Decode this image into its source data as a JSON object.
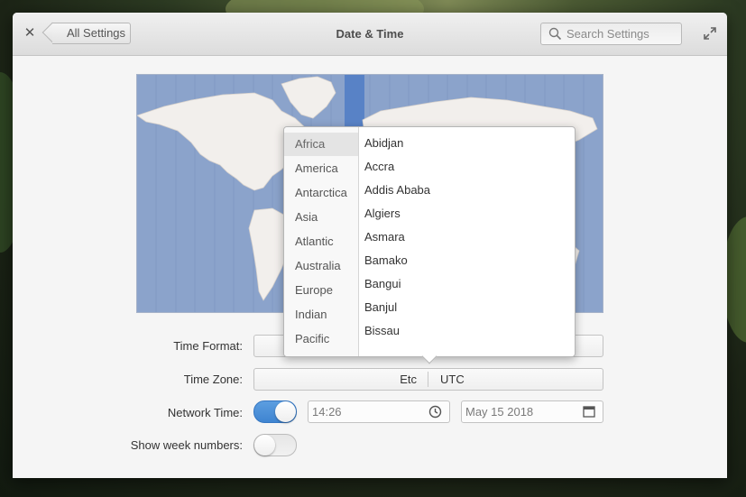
{
  "window": {
    "title": "Date & Time",
    "back_label": "All Settings",
    "search_placeholder": "Search Settings"
  },
  "icons": {
    "close": "close-icon",
    "maximize": "maximize-icon",
    "search": "search-icon",
    "clock": "clock-icon",
    "calendar": "calendar-icon"
  },
  "form": {
    "time_format_label": "Time Format:",
    "time_zone_label": "Time Zone:",
    "time_zone_region": "Etc",
    "time_zone_city": "UTC",
    "network_time_label": "Network Time:",
    "network_time_on": true,
    "time_value": "14:26",
    "date_value": "May 15 2018",
    "week_numbers_label": "Show week numbers:",
    "week_numbers_on": false
  },
  "timezone_popover": {
    "regions": [
      "Africa",
      "America",
      "Antarctica",
      "Asia",
      "Atlantic",
      "Australia",
      "Europe",
      "Indian",
      "Pacific"
    ],
    "selected_region": "Africa",
    "cities": [
      "Abidjan",
      "Accra",
      "Addis Ababa",
      "Algiers",
      "Asmara",
      "Bamako",
      "Bangui",
      "Banjul",
      "Bissau"
    ]
  },
  "colors": {
    "accent": "#3f84d1",
    "map_ocean": "#8ba3cb",
    "map_land": "#f2efec",
    "map_highlight": "#4f7cc6"
  }
}
